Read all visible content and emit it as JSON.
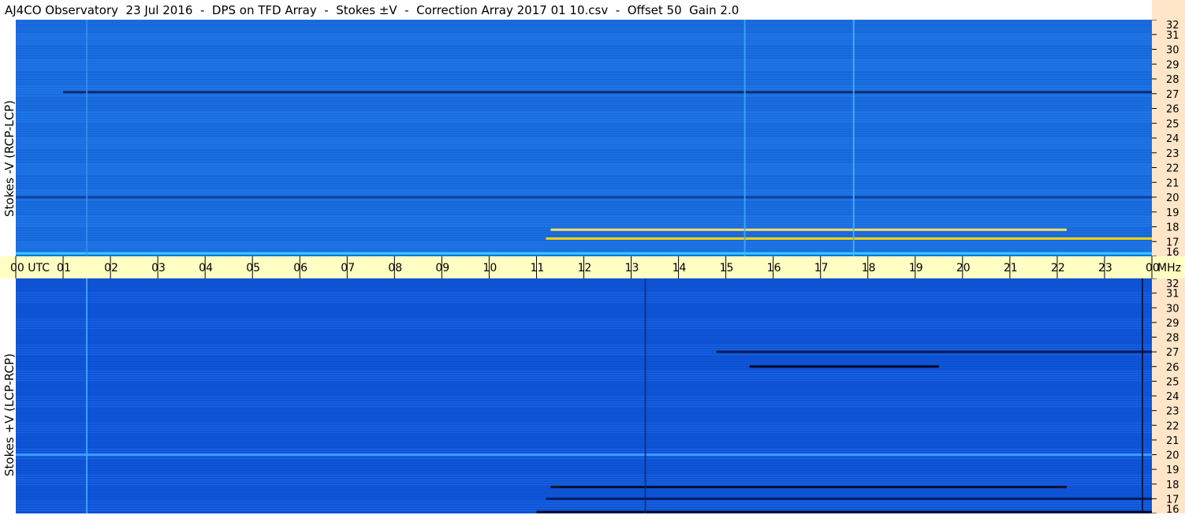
{
  "title": "AJ4CO Observatory  23 Jul 2016  -  DPS on TFD Array  -  Stokes ±V  -  Correction Array 2017 01 10.csv  -  Offset 50  Gain 2.0",
  "chart_data": [
    {
      "type": "heatmap",
      "panel": "top",
      "ylabel": "Stokes -V (RCP-LCP)",
      "ylim": [
        16,
        32
      ],
      "yticks": [
        "16",
        "17",
        "18",
        "19",
        "20",
        "21",
        "22",
        "23",
        "24",
        "25",
        "26",
        "27",
        "28",
        "29",
        "30",
        "31",
        "32"
      ],
      "xlim": [
        0,
        24
      ],
      "background_color": "#1a6ee0",
      "features": [
        {
          "kind": "band",
          "freq": 27.1,
          "t_start": 1.0,
          "t_end": 24.0,
          "color": "#0a2a70"
        },
        {
          "kind": "band",
          "freq": 17.8,
          "t_start": 11.3,
          "t_end": 22.2,
          "color": "#ffe066"
        },
        {
          "kind": "band",
          "freq": 17.2,
          "t_start": 11.2,
          "t_end": 24.0,
          "color": "#ffd000"
        },
        {
          "kind": "band",
          "freq": 16.2,
          "t_start": 0.0,
          "t_end": 24.0,
          "color": "#2fd0ff"
        },
        {
          "kind": "band",
          "freq": 20.0,
          "t_start": 0.0,
          "t_end": 24.0,
          "color": "#0c40a0"
        },
        {
          "kind": "vline",
          "time": 1.5,
          "color": "#3a90f0"
        },
        {
          "kind": "vline",
          "time": 15.4,
          "color": "#3fb0f8"
        },
        {
          "kind": "vline",
          "time": 17.7,
          "color": "#4fb8ff"
        }
      ]
    },
    {
      "type": "heatmap",
      "panel": "bottom",
      "ylabel": "Stokes +V (LCP-RCP)",
      "ylim": [
        16,
        32
      ],
      "yticks": [
        "16",
        "17",
        "18",
        "19",
        "20",
        "21",
        "22",
        "23",
        "24",
        "25",
        "26",
        "27",
        "28",
        "29",
        "30",
        "31",
        "32"
      ],
      "xlim": [
        0,
        24
      ],
      "background_color": "#0f55d8",
      "features": [
        {
          "kind": "band",
          "freq": 27.0,
          "t_start": 14.8,
          "t_end": 24.0,
          "color": "#061a50"
        },
        {
          "kind": "band",
          "freq": 26.0,
          "t_start": 15.5,
          "t_end": 19.5,
          "color": "#020820"
        },
        {
          "kind": "band",
          "freq": 17.8,
          "t_start": 11.3,
          "t_end": 22.2,
          "color": "#021030"
        },
        {
          "kind": "band",
          "freq": 17.0,
          "t_start": 11.2,
          "t_end": 24.0,
          "color": "#061c60"
        },
        {
          "kind": "band",
          "freq": 16.1,
          "t_start": 11.0,
          "t_end": 24.0,
          "color": "#020a28"
        },
        {
          "kind": "band",
          "freq": 20.0,
          "t_start": 0.0,
          "t_end": 24.0,
          "color": "#3d9aff"
        },
        {
          "kind": "vline",
          "time": 1.5,
          "color": "#4fb0ff"
        },
        {
          "kind": "vline",
          "time": 13.3,
          "color": "#062a80"
        },
        {
          "kind": "vline",
          "time": 23.8,
          "color": "#020a28"
        }
      ]
    }
  ],
  "time_axis": {
    "labels": [
      "00  UTC",
      "01",
      "02",
      "03",
      "04",
      "05",
      "06",
      "07",
      "08",
      "09",
      "10",
      "11",
      "12",
      "13",
      "14",
      "15",
      "16",
      "17",
      "18",
      "19",
      "20",
      "21",
      "22",
      "23",
      "00"
    ],
    "unit": "MHz"
  },
  "colors": {
    "axis_bg": "#ffffc4",
    "tick_bg": "#ffe6c9"
  }
}
